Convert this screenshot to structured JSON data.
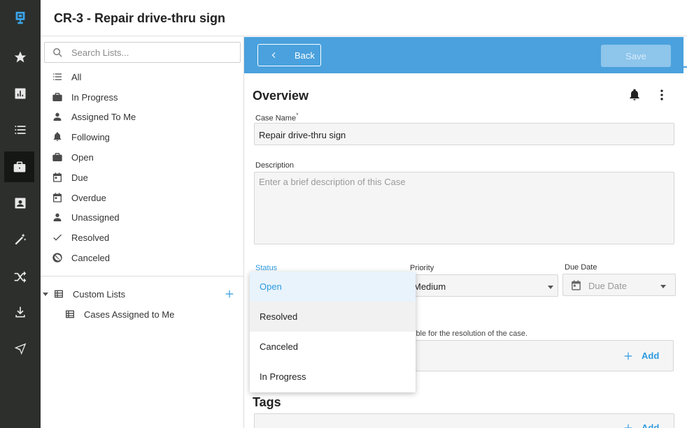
{
  "header": {
    "title": "CR-3 - Repair drive-thru sign"
  },
  "rail": {
    "items": [
      "logo-icon",
      "star-icon",
      "chart-icon",
      "list-icon",
      "briefcase-icon",
      "contact-icon",
      "wand-icon",
      "shuffle-icon",
      "download-icon",
      "send-icon"
    ],
    "active": "briefcase-icon"
  },
  "lists": {
    "search_placeholder": "Search Lists...",
    "items": [
      {
        "label": "All",
        "icon": "list-icon"
      },
      {
        "label": "In Progress",
        "icon": "briefcase-icon"
      },
      {
        "label": "Assigned To Me",
        "icon": "person-icon"
      },
      {
        "label": "Following",
        "icon": "bell-icon"
      },
      {
        "label": "Open",
        "icon": "briefcase-icon"
      },
      {
        "label": "Due",
        "icon": "calendar-icon"
      },
      {
        "label": "Overdue",
        "icon": "calendar-icon"
      },
      {
        "label": "Unassigned",
        "icon": "person-icon"
      },
      {
        "label": "Resolved",
        "icon": "check-icon"
      },
      {
        "label": "Canceled",
        "icon": "block-icon"
      }
    ],
    "custom_lists_label": "Custom Lists",
    "custom_items": [
      {
        "label": "Cases Assigned to Me"
      }
    ]
  },
  "toolbar": {
    "back_label": "Back",
    "save_label": "Save"
  },
  "form": {
    "section_title": "Overview",
    "case_name_label": "Case Name",
    "required_mark": "*",
    "case_name_value": "Repair drive-thru sign",
    "description_label": "Description",
    "description_placeholder": "Enter a brief description of this Case",
    "status_label": "Status",
    "priority_label": "Priority",
    "priority_value": "Medium",
    "due_date_label": "Due Date",
    "due_date_placeholder": "Due Date",
    "assignee_help": "ible for the resolution of the case.",
    "add_label": "Add",
    "tags_title": "Tags"
  },
  "status_dropdown": {
    "options": [
      "Open",
      "Resolved",
      "Canceled",
      "In Progress"
    ],
    "selected": "Open",
    "hovered": "Resolved"
  },
  "colors": {
    "accent": "#4aa1dd",
    "link": "#2d9be0",
    "rail": "#2c2f2c"
  }
}
